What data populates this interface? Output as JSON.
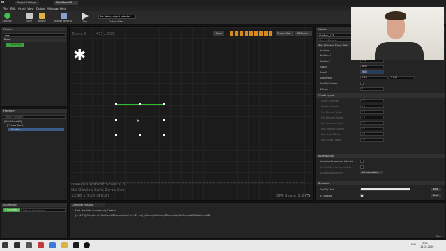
{
  "window": {
    "tabs": [
      "Project Settings",
      "MainMenuWB"
    ],
    "app_logo": "U"
  },
  "menu": [
    "File",
    "Edit",
    "Asset",
    "View",
    "Debug",
    "Window",
    "Help"
  ],
  "toolbar": {
    "buttons": [
      {
        "label": "Compile",
        "icon": "compile-icon",
        "color": "#3fbf4b"
      },
      {
        "label": "Save",
        "icon": "save-icon",
        "color": "#c9c9c9"
      },
      {
        "label": "Browse",
        "icon": "browse-icon",
        "color": "#d8b34a"
      },
      {
        "label": "Widget Reflector",
        "icon": "reflector-icon",
        "color": "#8aa0c8"
      },
      {
        "label": "Play",
        "icon": "play-icon",
        "color": "#dcdcdc"
      }
    ],
    "debug_filter_value": "No debug object selected",
    "debug_filter_label": "Debug Filter"
  },
  "palette": {
    "title": "Palette",
    "search_value": "size",
    "category": "Panel",
    "item": "Size Box"
  },
  "hierarchy": {
    "title": "Hierarchy",
    "search_placeholder": "Search Widgets",
    "items": [
      "[MainMenuWB]",
      "[Canvas Panel]",
      "SizeBox"
    ]
  },
  "designer": {
    "zoom": "Zoom -2",
    "size_readout": "451 x 538",
    "mode_none": "None",
    "screen_size": "Screen Size",
    "fill_screen": "Fill Screen",
    "content_scale": "Device Content Scale 1.0",
    "safe_zone": "No Device Safe Zone Set",
    "resolution": "1280 x 720 (16:9)",
    "dpi_scale": "DPI Scale 0.67"
  },
  "animations": {
    "title": "Animations",
    "add_button": "+ Animation",
    "search_placeholder": "Search Animations"
  },
  "compiler": {
    "title": "Compiler Results",
    "lines": [
      "Font Template Successfully Created",
      "[1:41:75] Compile of MainMenuWB successful! [in 307 ms] (/Game/MainMenu/Blueprints/MainMenuWB.MainMenuWB)"
    ],
    "clear": "Clear"
  },
  "details": {
    "title": "Details",
    "name_value": "SizeBox_115",
    "search_placeholder": "Search Details",
    "slot_header": "Slot (Canvas Panel Slot)",
    "anchors_header": "Anchors",
    "rows": [
      {
        "label": "Position X",
        "value": "3043"
      },
      {
        "label": "Position Y",
        "value": "4252"
      },
      {
        "label": "Size X",
        "value": "4053"
      },
      {
        "label": "Size Y",
        "value": "2800"
      },
      {
        "label": "Alignment",
        "value": "X  0.0",
        "value2": "Y  0.0"
      },
      {
        "label": "Size To Content",
        "value": ""
      },
      {
        "label": "ZOrder",
        "value": "0"
      }
    ],
    "child_layout_header": "Child Layout",
    "child_rows": [
      {
        "label": "Width Override",
        "value": "0.0"
      },
      {
        "label": "Height Override",
        "value": "0.0"
      },
      {
        "label": "Min Desired Width",
        "value": "0.0"
      },
      {
        "label": "Min Desired Height",
        "value": "0.0"
      },
      {
        "label": "Max Desired Width",
        "value": "0.0"
      },
      {
        "label": "Max Desired Height",
        "value": "0.0"
      },
      {
        "label": "Min Aspect Ratio",
        "value": "1.0"
      },
      {
        "label": "Max Aspect Ratio",
        "value": "1.0"
      }
    ],
    "accessibility_header": "Accessibility",
    "acc_rows": [
      {
        "label": "Override Accessible Defaults"
      },
      {
        "label": "Can Children be Accessible"
      },
      {
        "label": "Accessible Behavior",
        "value": "Not Accessible"
      }
    ],
    "behavior_header": "Behavior",
    "beh_rows": [
      {
        "label": "Tool Tip Text",
        "bind": "Bind"
      },
      {
        "label": "Is Enabled",
        "bind": "Bind"
      }
    ]
  },
  "taskbar": {
    "time": "3:54",
    "date": "14.04.2020",
    "lang": "ENG"
  },
  "colors": {
    "accent": "#d88a1c",
    "selection": "#2fbf2f",
    "green_item": "#3f9f3f"
  }
}
